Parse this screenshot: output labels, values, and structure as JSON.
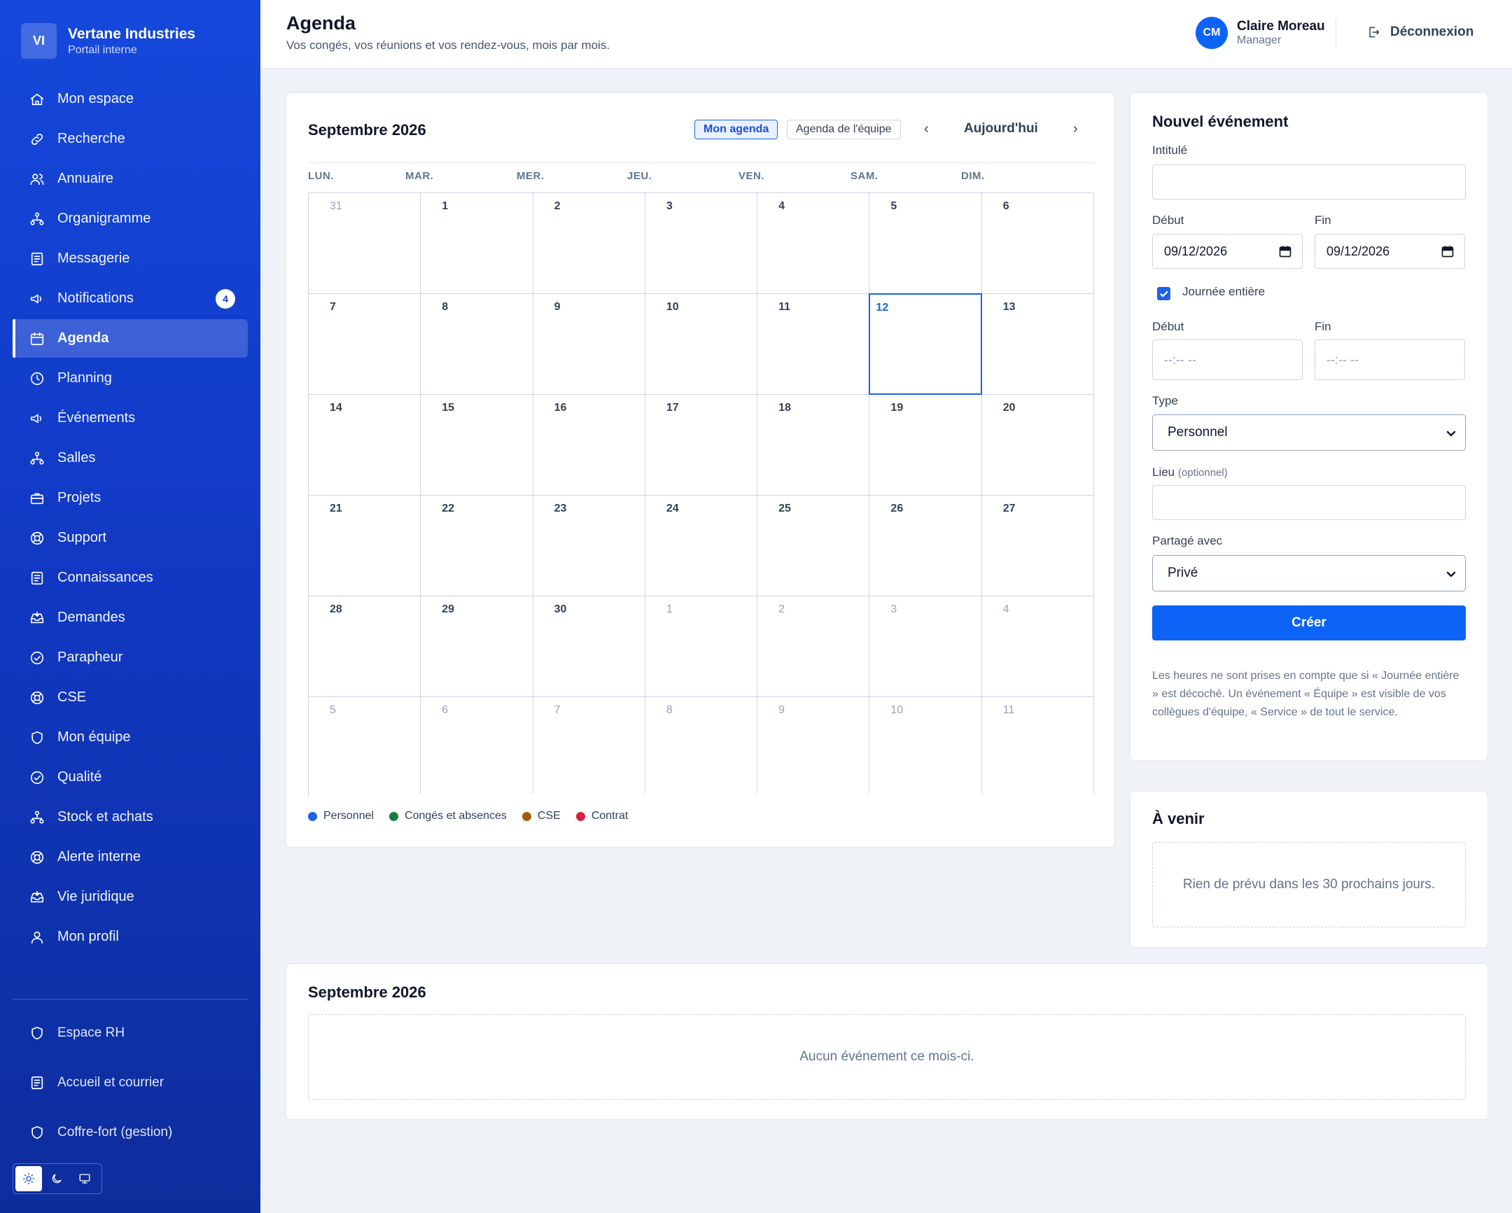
{
  "brand": {
    "initials": "VI",
    "name": "Vertane Industries",
    "subtitle": "Portail interne"
  },
  "sidebar": {
    "items": [
      {
        "label": "Mon espace",
        "icon": "home-icon"
      },
      {
        "label": "Recherche",
        "icon": "link-icon"
      },
      {
        "label": "Annuaire",
        "icon": "users-icon"
      },
      {
        "label": "Organigramme",
        "icon": "org-chart-icon"
      },
      {
        "label": "Messagerie",
        "icon": "document-icon"
      },
      {
        "label": "Notifications",
        "icon": "megaphone-icon",
        "badge": "4"
      },
      {
        "label": "Agenda",
        "icon": "calendar-icon",
        "active": true
      },
      {
        "label": "Planning",
        "icon": "clock-icon"
      },
      {
        "label": "Événements",
        "icon": "megaphone-icon"
      },
      {
        "label": "Salles",
        "icon": "org-chart-icon"
      },
      {
        "label": "Projets",
        "icon": "briefcase-icon"
      },
      {
        "label": "Support",
        "icon": "lifebuoy-icon"
      },
      {
        "label": "Connaissances",
        "icon": "document-icon"
      },
      {
        "label": "Demandes",
        "icon": "inbox-icon"
      },
      {
        "label": "Parapheur",
        "icon": "check-circle-icon"
      },
      {
        "label": "CSE",
        "icon": "lifebuoy-icon"
      },
      {
        "label": "Mon équipe",
        "icon": "shield-icon"
      },
      {
        "label": "Qualité",
        "icon": "check-circle-icon"
      },
      {
        "label": "Stock et achats",
        "icon": "org-chart-icon"
      },
      {
        "label": "Alerte interne",
        "icon": "lifebuoy-icon"
      },
      {
        "label": "Vie juridique",
        "icon": "inbox-icon"
      },
      {
        "label": "Mon profil",
        "icon": "user-icon"
      }
    ],
    "bottom_items": [
      {
        "label": "Espace RH",
        "icon": "shield-icon"
      },
      {
        "label": "Accueil et courrier",
        "icon": "document-icon"
      },
      {
        "label": "Coffre-fort (gestion)",
        "icon": "shield-icon"
      }
    ],
    "theme_modes": [
      "sun-icon",
      "moon-icon",
      "monitor-icon"
    ]
  },
  "header": {
    "title": "Agenda",
    "subtitle": "Vos congés, vos réunions et vos rendez-vous, mois par mois.",
    "user": {
      "initials": "CM",
      "name": "Claire Moreau",
      "role": "Manager"
    },
    "logout_label": "Déconnexion"
  },
  "calendar": {
    "month_label": "Septembre 2026",
    "view_mine": "Mon agenda",
    "view_team": "Agenda de l'équipe",
    "prev": "‹",
    "today": "Aujourd'hui",
    "next": "›",
    "weekdays": [
      "LUN.",
      "MAR.",
      "MER.",
      "JEU.",
      "VEN.",
      "SAM.",
      "DIM."
    ],
    "weeks": [
      [
        {
          "d": "31",
          "other": true
        },
        {
          "d": "1"
        },
        {
          "d": "2"
        },
        {
          "d": "3"
        },
        {
          "d": "4"
        },
        {
          "d": "5"
        },
        {
          "d": "6"
        }
      ],
      [
        {
          "d": "7"
        },
        {
          "d": "8"
        },
        {
          "d": "9"
        },
        {
          "d": "10"
        },
        {
          "d": "11"
        },
        {
          "d": "12",
          "today": true
        },
        {
          "d": "13"
        }
      ],
      [
        {
          "d": "14"
        },
        {
          "d": "15"
        },
        {
          "d": "16"
        },
        {
          "d": "17"
        },
        {
          "d": "18"
        },
        {
          "d": "19"
        },
        {
          "d": "20"
        }
      ],
      [
        {
          "d": "21"
        },
        {
          "d": "22"
        },
        {
          "d": "23"
        },
        {
          "d": "24"
        },
        {
          "d": "25"
        },
        {
          "d": "26"
        },
        {
          "d": "27"
        }
      ],
      [
        {
          "d": "28"
        },
        {
          "d": "29"
        },
        {
          "d": "30"
        },
        {
          "d": "1",
          "other": true
        },
        {
          "d": "2",
          "other": true
        },
        {
          "d": "3",
          "other": true
        },
        {
          "d": "4",
          "other": true
        }
      ],
      [
        {
          "d": "5",
          "other": true
        },
        {
          "d": "6",
          "other": true
        },
        {
          "d": "7",
          "other": true
        },
        {
          "d": "8",
          "other": true
        },
        {
          "d": "9",
          "other": true
        },
        {
          "d": "10",
          "other": true
        },
        {
          "d": "11",
          "other": true
        }
      ]
    ],
    "legend": [
      {
        "label": "Personnel",
        "color": "#1d63e8"
      },
      {
        "label": "Congés et absences",
        "color": "#15803d"
      },
      {
        "label": "CSE",
        "color": "#a15c07"
      },
      {
        "label": "Contrat",
        "color": "#dc1f3c"
      }
    ]
  },
  "form": {
    "title": "Nouvel événement",
    "title_label": "Intitulé",
    "title_value": "",
    "start_label": "Début",
    "end_label": "Fin",
    "start_date": "09/12/2026",
    "end_date": "09/12/2026",
    "all_day_label": "Journée entière",
    "start_time_label": "Début",
    "end_time_label": "Fin",
    "time_placeholder": "--:-- --",
    "type_label": "Type",
    "type_value": "Personnel",
    "place_label": "Lieu",
    "place_optional": "(optionnel)",
    "place_value": "",
    "shared_label": "Partagé avec",
    "shared_value": "Privé",
    "submit": "Créer",
    "help": "Les heures ne sont prises en compte que si « Journée entière » est décoché. Un événement « Équipe » est visible de vos collègues d'équipe, « Service » de tout le service."
  },
  "upcoming": {
    "title": "À venir",
    "empty": "Rien de prévu dans les 30 prochains jours."
  },
  "month_list": {
    "title": "Septembre 2026",
    "empty": "Aucun événement ce mois-ci."
  },
  "colors": {
    "accent": "#0d63f5",
    "sidebar": "#1548dc"
  }
}
